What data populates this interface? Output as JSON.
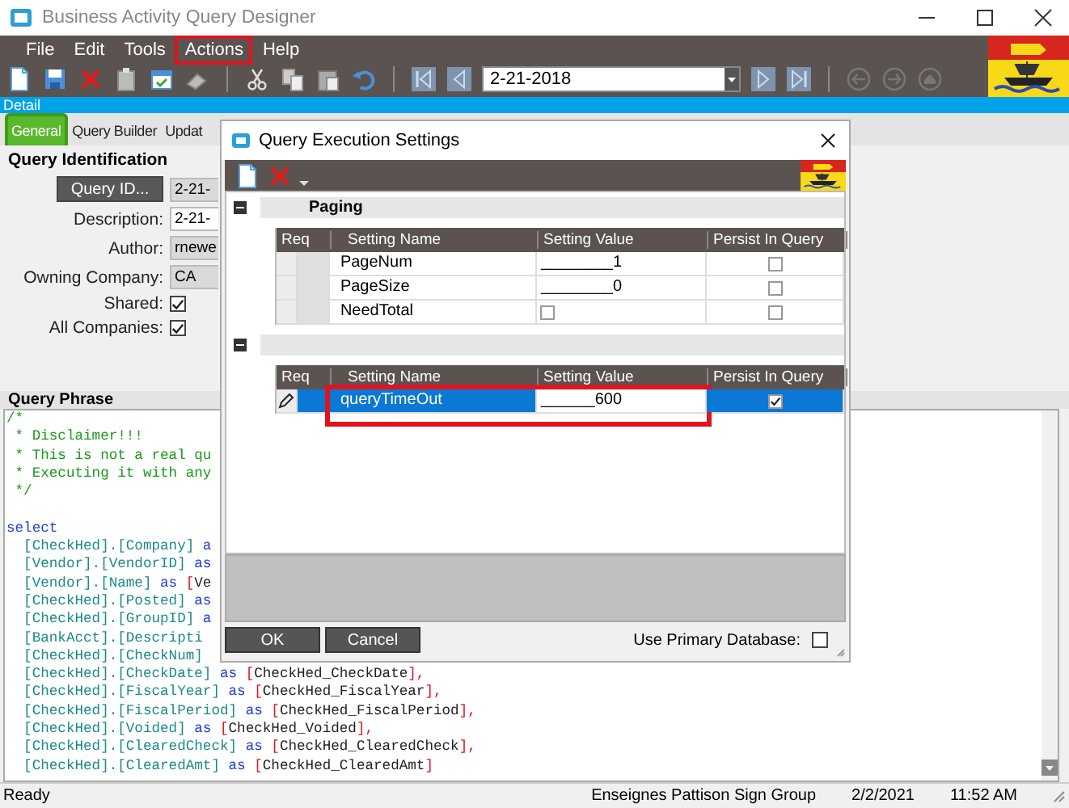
{
  "window": {
    "title": "Business Activity Query Designer"
  },
  "menu": [
    {
      "label": "File",
      "annotated": false
    },
    {
      "label": "Edit",
      "annotated": false
    },
    {
      "label": "Tools",
      "annotated": false
    },
    {
      "label": "Actions",
      "annotated": true
    },
    {
      "label": "Help",
      "annotated": false
    }
  ],
  "toolbar": {
    "date": "2-21-2018"
  },
  "detail_bar": "Detail",
  "tabs": [
    {
      "label": "General",
      "selected": true
    },
    {
      "label": "Query Builder",
      "selected": false
    },
    {
      "label": "Updat",
      "selected": false
    }
  ],
  "query_identification": {
    "title": "Query Identification",
    "query_id_button": "Query ID...",
    "query_id_value": "2-21-",
    "fields": [
      {
        "label": "Description:",
        "kind": "text",
        "value": "2-21-",
        "read_only": false
      },
      {
        "label": "Author:",
        "kind": "text",
        "value": "rnewe",
        "read_only": true
      },
      {
        "label": "Owning Company:",
        "kind": "text",
        "value": "CA",
        "read_only": true
      },
      {
        "label": "Shared:",
        "kind": "checkbox",
        "checked": true
      },
      {
        "label": "All Companies:",
        "kind": "checkbox",
        "checked": true
      }
    ]
  },
  "query_phrase": {
    "title": "Query Phrase",
    "blocks": [
      {
        "lines": [
          {
            "tokens": [
              {
                "kind": "comment",
                "text": "/*"
              }
            ]
          },
          {
            "tokens": [
              {
                "kind": "comment",
                "text": " * Disclaimer!!!"
              }
            ]
          },
          {
            "tokens": [
              {
                "kind": "comment",
                "text": " * This is not a real qu"
              }
            ]
          },
          {
            "tokens": [
              {
                "kind": "comment",
                "text": " * Executing it with any"
              }
            ]
          },
          {
            "tokens": [
              {
                "kind": "comment",
                "text": " */"
              }
            ]
          }
        ]
      },
      {
        "lines": [
          {
            "tokens": [
              {
                "kind": "keyword",
                "text": "select"
              }
            ]
          },
          {
            "tokens": [
              {
                "kind": "ident",
                "text": "  [CheckHed].[Company]"
              },
              {
                "kind": "keyword",
                "text": " a"
              }
            ]
          },
          {
            "tokens": [
              {
                "kind": "ident",
                "text": "  [Vendor].[VendorID]"
              },
              {
                "kind": "keyword",
                "text": " as"
              }
            ]
          },
          {
            "tokens": [
              {
                "kind": "ident",
                "text": "  [Vendor].[Name]"
              },
              {
                "kind": "keyword",
                "text": " as "
              },
              {
                "kind": "bracket",
                "text": "["
              },
              {
                "kind": "alias",
                "text": "Ve"
              }
            ]
          },
          {
            "tokens": [
              {
                "kind": "ident",
                "text": "  [CheckHed].[Posted]"
              },
              {
                "kind": "keyword",
                "text": " as"
              }
            ]
          },
          {
            "tokens": [
              {
                "kind": "ident",
                "text": "  [CheckHed].[GroupID]"
              },
              {
                "kind": "keyword",
                "text": " a"
              }
            ]
          },
          {
            "tokens": [
              {
                "kind": "ident",
                "text": "  [BankAcct].[Descripti"
              }
            ]
          },
          {
            "tokens": [
              {
                "kind": "ident",
                "text": "  [CheckHed].[CheckNum]"
              }
            ]
          },
          {
            "tokens": [
              {
                "kind": "ident",
                "text": "  [CheckHed].[CheckDate]"
              },
              {
                "kind": "keyword",
                "text": " as "
              },
              {
                "kind": "bracket",
                "text": "["
              },
              {
                "kind": "alias",
                "text": "CheckHed_CheckDate"
              },
              {
                "kind": "bracket",
                "text": "],"
              }
            ]
          },
          {
            "tokens": [
              {
                "kind": "ident",
                "text": "  [CheckHed].[FiscalYear]"
              },
              {
                "kind": "keyword",
                "text": " as "
              },
              {
                "kind": "bracket",
                "text": "["
              },
              {
                "kind": "alias",
                "text": "CheckHed_FiscalYear"
              },
              {
                "kind": "bracket",
                "text": "],"
              }
            ]
          },
          {
            "tokens": [
              {
                "kind": "ident",
                "text": "  [CheckHed].[FiscalPeriod]"
              },
              {
                "kind": "keyword",
                "text": " as "
              },
              {
                "kind": "bracket",
                "text": "["
              },
              {
                "kind": "alias",
                "text": "CheckHed_FiscalPeriod"
              },
              {
                "kind": "bracket",
                "text": "],"
              }
            ]
          },
          {
            "tokens": [
              {
                "kind": "ident",
                "text": "  [CheckHed].[Voided]"
              },
              {
                "kind": "keyword",
                "text": " as "
              },
              {
                "kind": "bracket",
                "text": "["
              },
              {
                "kind": "alias",
                "text": "CheckHed_Voided"
              },
              {
                "kind": "bracket",
                "text": "],"
              }
            ]
          },
          {
            "tokens": [
              {
                "kind": "ident",
                "text": "  [CheckHed].[ClearedCheck]"
              },
              {
                "kind": "keyword",
                "text": " as "
              },
              {
                "kind": "bracket",
                "text": "["
              },
              {
                "kind": "alias",
                "text": "CheckHed_ClearedCheck"
              },
              {
                "kind": "bracket",
                "text": "],"
              }
            ]
          },
          {
            "tokens": [
              {
                "kind": "ident",
                "text": "  [CheckHed].[ClearedAmt]"
              },
              {
                "kind": "keyword",
                "text": " as "
              },
              {
                "kind": "bracket",
                "text": "["
              },
              {
                "kind": "alias",
                "text": "CheckHed_ClearedAmt"
              },
              {
                "kind": "bracket",
                "text": "]"
              }
            ]
          }
        ]
      }
    ]
  },
  "status_bar": {
    "message": "Ready",
    "company": "Enseignes Pattison Sign Group",
    "date": "2/2/2021",
    "time": "11:52 AM"
  },
  "dialog": {
    "title": "Query Execution Settings",
    "groups": [
      {
        "title": "Paging",
        "expanded": true,
        "columns": [
          "Req",
          "Setting Name",
          "Setting Value",
          "Persist In Query"
        ],
        "rows": [
          {
            "name": "PageNum",
            "kind": "text",
            "value": "________1",
            "persist": false,
            "selected": false,
            "editing": false,
            "annotated": false
          },
          {
            "name": "PageSize",
            "kind": "text",
            "value": "________0",
            "persist": false,
            "selected": false,
            "editing": false,
            "annotated": false
          },
          {
            "name": "NeedTotal",
            "kind": "checkbox",
            "checked": false,
            "persist": false,
            "selected": false,
            "editing": false,
            "annotated": false
          }
        ]
      },
      {
        "expanded": true,
        "columns": [
          "Req",
          "Setting Name",
          "Setting Value",
          "Persist In Query"
        ],
        "rows": [
          {
            "name": "queryTimeOut",
            "kind": "text",
            "value": "______600",
            "persist": true,
            "selected": true,
            "editing": true,
            "annotated": true
          }
        ]
      }
    ],
    "buttons": [
      "OK",
      "Cancel"
    ],
    "primary_database": {
      "label": "Use Primary Database:",
      "checked": false
    }
  }
}
